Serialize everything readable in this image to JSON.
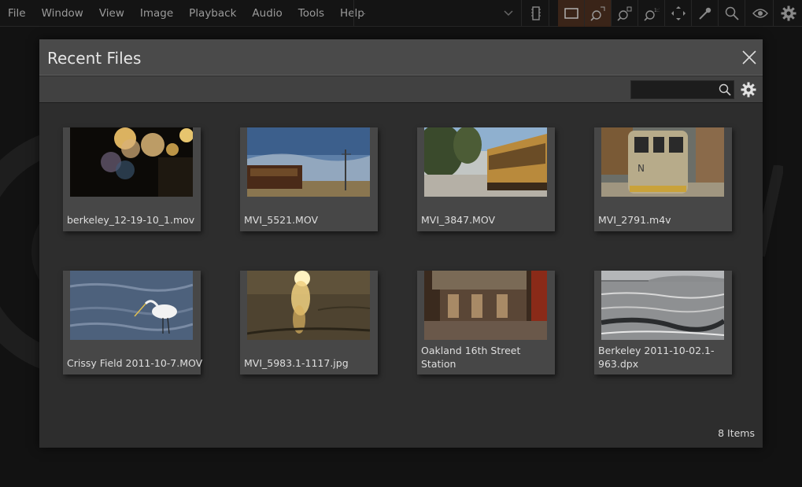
{
  "menubar": {
    "items": [
      "File",
      "Window",
      "View",
      "Image",
      "Playback",
      "Audio",
      "Tools",
      "Help"
    ],
    "combo_value": "-"
  },
  "toolbar_icons": [
    "film-strip-icon",
    "frame-icon",
    "zoom-fit-icon",
    "zoom-in-icon",
    "zoom-actual-icon",
    "move-icon",
    "eyedropper-icon",
    "magnifier-icon",
    "eye-icon",
    "gear-icon"
  ],
  "dialog": {
    "title": "Recent Files",
    "search_placeholder": "",
    "item_count": "8 Items",
    "files": [
      {
        "name": "berkeley_12-19-10_1.mov",
        "thumb": "bokeh-lights"
      },
      {
        "name": "MVI_5521.MOV",
        "thumb": "trolley-field"
      },
      {
        "name": "MVI_3847.MOV",
        "thumb": "yellow-trolley"
      },
      {
        "name": "MVI_2791.m4v",
        "thumb": "train-front"
      },
      {
        "name": "Crissy Field 2011-10-7.MOV",
        "thumb": "egret-water"
      },
      {
        "name": "MVI_5983.1-1117.jpg",
        "thumb": "sunlit-water"
      },
      {
        "name": "Oakland 16th Street Station",
        "thumb": "station-interior"
      },
      {
        "name": "Berkeley 2011-10-02.1-963.dpx",
        "thumb": "bay-waves"
      }
    ]
  },
  "colors": {
    "dialog_bg": "#2d2d2d",
    "header_bg": "#4a4a4a",
    "card_bg": "#474747",
    "active_tool": "#3a2418",
    "accent": "#c8632a"
  }
}
